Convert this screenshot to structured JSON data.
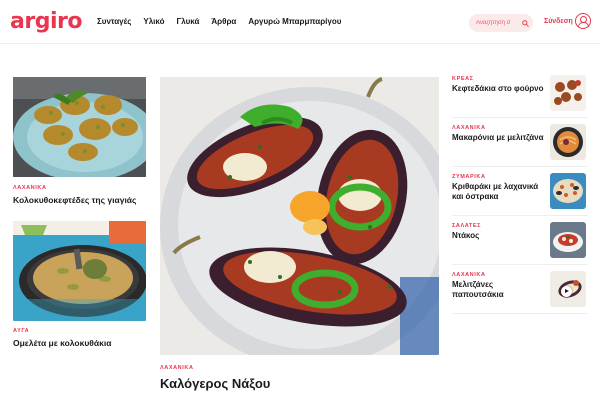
{
  "header": {
    "logo": "argiro",
    "nav": [
      "Συνταγές",
      "Υλικό",
      "Γλυκά",
      "Άρθρα",
      "Αργυρώ Μπαρμπαρίγου"
    ],
    "search_placeholder": "Αναζήτηση σ",
    "login_label": "Σύνδεση"
  },
  "left_cards": [
    {
      "category": "ΛΑΧΑΝΙΚΑ",
      "title": "Κολοκυθοκεφτέδες της γιαγιάς"
    },
    {
      "category": "ΑΥΓΑ",
      "title": "Ομελέτα με κολοκυθάκια"
    }
  ],
  "featured": {
    "category": "ΛΑΧΑΝΙΚΑ",
    "title": "Καλόγερος Νάξου"
  },
  "right_list": [
    {
      "category": "ΚΡΕΑΣ",
      "title": "Κεφτεδάκια στο φούρνο",
      "thumb": "meatballs"
    },
    {
      "category": "ΛΑΧΑΝΙΚΑ",
      "title": "Μακαρόνια με μελιτζάνα",
      "thumb": "pasta"
    },
    {
      "category": "ΖΥΜΑΡΙΚΑ",
      "title": "Κριθαράκι με λαχανικά και όστρακα",
      "thumb": "orzo"
    },
    {
      "category": "ΣΑΛΑΤΕΣ",
      "title": "Ντάκος",
      "thumb": "dakos"
    },
    {
      "category": "ΛΑΧΑΝΙΚΑ",
      "title": "Μελιτζάνες παπουτσάκια",
      "thumb": "papoutsakia"
    }
  ],
  "colors": {
    "accent": "#e8364f",
    "text": "#1a1a1a"
  },
  "icons": [
    "search-icon",
    "user-icon",
    "play-icon"
  ]
}
